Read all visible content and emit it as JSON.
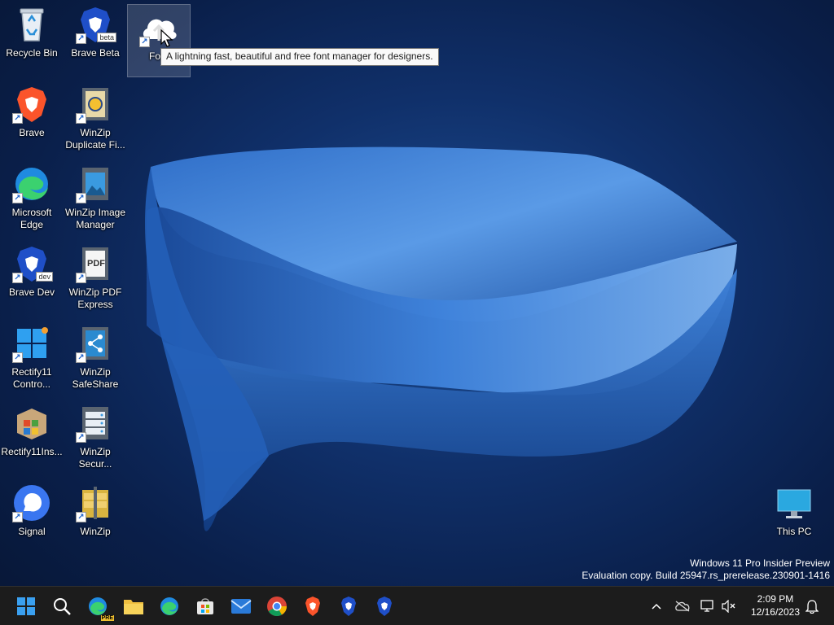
{
  "desktop": {
    "icons": [
      {
        "label": "Recycle Bin",
        "icon": "recycle-bin-icon"
      },
      {
        "label": "Brave Beta",
        "icon": "brave-beta-icon",
        "badge": "beta"
      },
      {
        "label": "Font",
        "icon": "font-manager-cloud-icon"
      },
      {
        "label": "Brave",
        "icon": "brave-icon"
      },
      {
        "label": "WinZip Duplicate Fi...",
        "icon": "winzip-duplicate-finder-icon"
      },
      {
        "label": "Microsoft Edge",
        "icon": "edge-icon"
      },
      {
        "label": "WinZip Image Manager",
        "icon": "winzip-image-manager-icon"
      },
      {
        "label": "Brave Dev",
        "icon": "brave-dev-icon",
        "badge": "dev"
      },
      {
        "label": "WinZip PDF Express",
        "icon": "winzip-pdf-express-icon",
        "badge": "PDF"
      },
      {
        "label": "Rectify11 Contro...",
        "icon": "rectify11-control-icon"
      },
      {
        "label": "WinZip SafeShare",
        "icon": "winzip-safeshare-icon"
      },
      {
        "label": "Rectify11Ins...",
        "icon": "rectify11-installer-icon"
      },
      {
        "label": "WinZip Secur...",
        "icon": "winzip-secure-backup-icon"
      },
      {
        "label": "Signal",
        "icon": "signal-icon"
      },
      {
        "label": "WinZip",
        "icon": "winzip-icon"
      },
      {
        "label": "This PC",
        "icon": "this-pc-icon"
      }
    ],
    "tooltip": "A lightning fast, beautiful and free font manager for designers."
  },
  "watermark": {
    "line1": "Windows 11 Pro Insider Preview",
    "line2": "Evaluation copy. Build 25947.rs_prerelease.230901-1416"
  },
  "taskbar": {
    "apps": [
      "start-icon",
      "search-icon",
      "edge-dev-icon",
      "file-explorer-icon",
      "edge-icon",
      "microsoft-store-icon",
      "mail-icon",
      "chrome-icon",
      "brave-icon",
      "brave-beta-icon",
      "brave-dev-icon"
    ],
    "edge_badge": "PRE",
    "time": "2:09 PM",
    "date": "12/16/2023"
  },
  "colors": {
    "accent": "#2a6fd6",
    "taskbar": "#1c1c1c"
  }
}
